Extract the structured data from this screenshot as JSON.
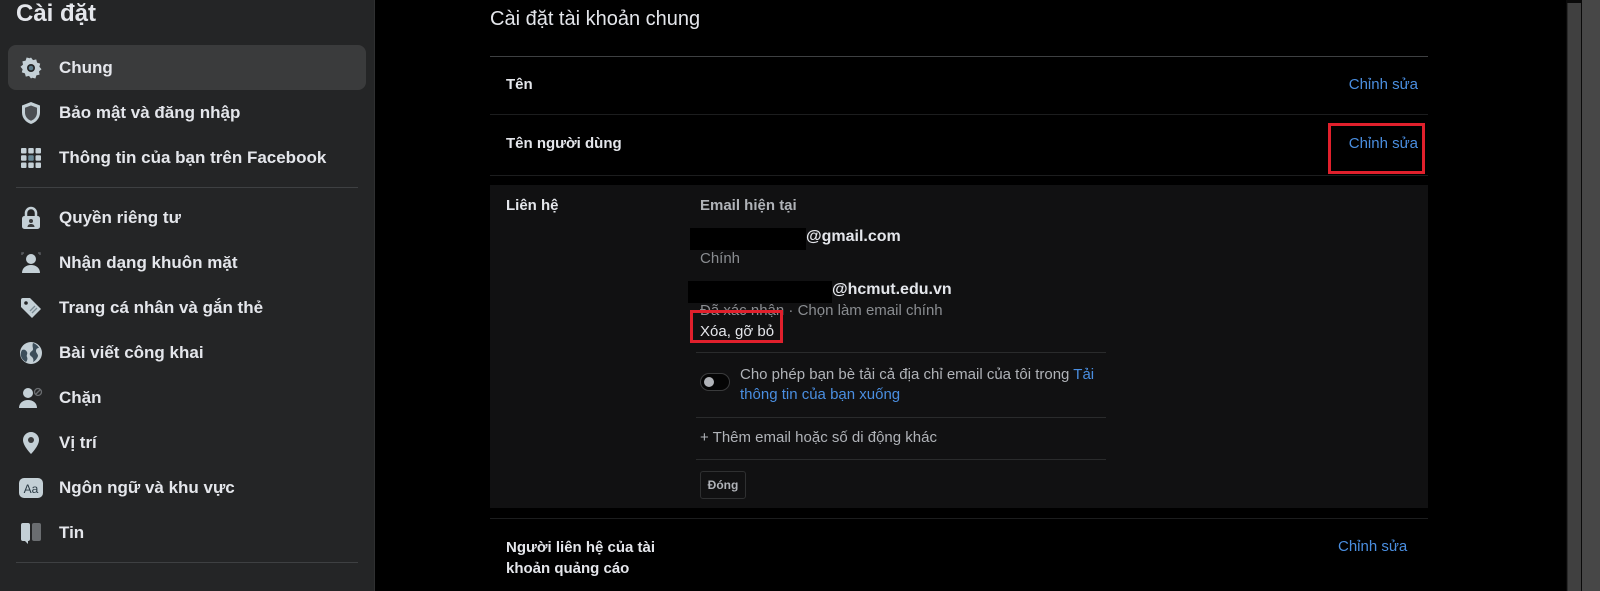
{
  "sidebar": {
    "title": "Cài đặt",
    "items": [
      {
        "label": "Chung",
        "icon": "gear-icon",
        "active": true
      },
      {
        "label": "Bảo mật và đăng nhập",
        "icon": "shield-icon"
      },
      {
        "label": "Thông tin của bạn trên Facebook",
        "icon": "grid-icon"
      },
      {
        "label": "Quyền riêng tư",
        "icon": "lock-icon"
      },
      {
        "label": "Nhận dạng khuôn mặt",
        "icon": "face-recognition-icon"
      },
      {
        "label": "Trang cá nhân và gắn thẻ",
        "icon": "tag-icon"
      },
      {
        "label": "Bài viết công khai",
        "icon": "globe-icon"
      },
      {
        "label": "Chặn",
        "icon": "block-user-icon"
      },
      {
        "label": "Vị trí",
        "icon": "location-pin-icon"
      },
      {
        "label": "Ngôn ngữ và khu vực",
        "icon": "language-icon"
      },
      {
        "label": "Tin",
        "icon": "stories-icon"
      }
    ]
  },
  "main": {
    "title": "Cài đặt tài khoản chung",
    "edit_label": "Chỉnh sửa",
    "rows": [
      {
        "label": "Tên"
      },
      {
        "label": "Tên người dùng"
      }
    ],
    "contact": {
      "label": "Liên hệ",
      "heading": "Email hiện tại",
      "emails": [
        {
          "address": "@gmail.com",
          "status": "Chính"
        },
        {
          "address": "@hcmut.edu.vn",
          "status": "Đã xác nhận",
          "separator": " · ",
          "make_primary": "Chọn làm email chính",
          "remove": "Xóa, gỡ bỏ"
        }
      ],
      "toggle": {
        "on": false,
        "text": "Cho phép bạn bè tải cả địa chỉ email của tôi trong ",
        "link": "Tải thông tin của bạn xuống"
      },
      "add_contact": "+ Thêm email hoặc số di động khác",
      "close_label": "Đóng"
    },
    "ads_contact": {
      "label": "Người liên hệ của tài khoản quảng cáo"
    }
  },
  "colors": {
    "link": "#4a8ee0",
    "highlight": "#e0202c",
    "sidebar_bg": "#242526",
    "active_item_bg": "#3a3b3c"
  }
}
